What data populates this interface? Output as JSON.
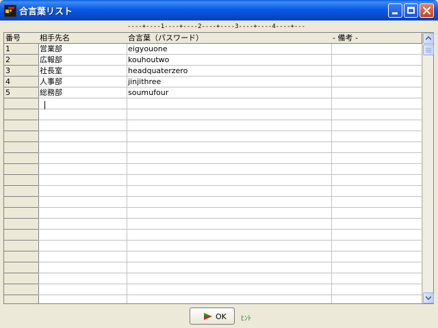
{
  "window": {
    "title": "合言葉リスト",
    "controls": {
      "minimize": "minimize",
      "maximize": "maximize",
      "close": "close"
    }
  },
  "ruler": "----+----1----+----2----+----3----+----4----+---",
  "table": {
    "columns": [
      "番号",
      "相手先名",
      "合言葉（パスワード）",
      "- 備考 -"
    ],
    "rows": [
      [
        "1",
        "営業部",
        "eigyouone",
        ""
      ],
      [
        "2",
        "広報部",
        "kouhoutwo",
        ""
      ],
      [
        "3",
        "社長室",
        "headquaterzero",
        ""
      ],
      [
        "4",
        "人事部",
        "jinjithree",
        ""
      ],
      [
        "5",
        "総務部",
        "soumufour",
        ""
      ]
    ],
    "empty_row_count": 19
  },
  "footer": {
    "ok_label": "OK",
    "hint": "ﾋﾝﾄ"
  },
  "colors": {
    "titlebar": "#0a5ae6",
    "window_bg": "#ece9d8",
    "ok_arrow_green": "#1a9a1a",
    "ok_arrow_red": "#d42020",
    "hint_green": "#2c7a2c"
  },
  "icons": {
    "app": "app-icon",
    "ok": "arrow-right-icon",
    "scroll_up": "chevron-up-icon",
    "scroll_down": "chevron-down-icon"
  }
}
